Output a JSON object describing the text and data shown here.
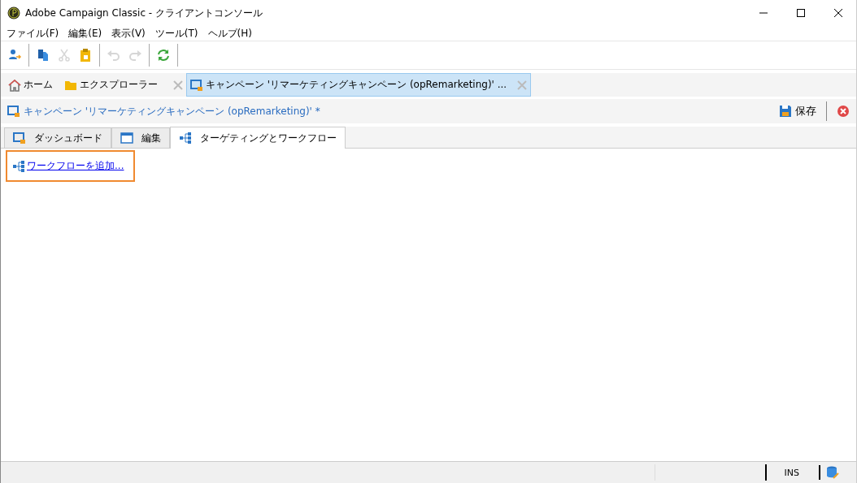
{
  "window": {
    "title": "Adobe Campaign Classic - クライアントコンソール"
  },
  "menu": [
    "ファイル(F)",
    "編集(E)",
    "表示(V)",
    "ツール(T)",
    "ヘルプ(H)"
  ],
  "toolbar": [
    {
      "kind": "person",
      "disabled": false
    },
    {
      "kind": "sep"
    },
    {
      "kind": "copy",
      "disabled": false
    },
    {
      "kind": "cut",
      "disabled": true
    },
    {
      "kind": "paste",
      "disabled": false
    },
    {
      "kind": "sep"
    },
    {
      "kind": "undo",
      "disabled": true
    },
    {
      "kind": "redo",
      "disabled": true
    },
    {
      "kind": "sep"
    },
    {
      "kind": "refresh",
      "disabled": false
    },
    {
      "kind": "sep"
    }
  ],
  "doc_tabs": [
    {
      "kind": "home",
      "label": "ホーム",
      "selected": false
    },
    {
      "kind": "folder",
      "label": "エクスプローラー",
      "selected": false
    },
    {
      "kind": "campaign",
      "label": "キャンペーン 'リマーケティングキャンペーン (opRemarketing)' ...",
      "selected": true
    }
  ],
  "header": {
    "title": "キャンペーン 'リマーケティングキャンペーン (opRemarketing)' *",
    "save": "保存"
  },
  "sub_tabs": [
    {
      "kind": "dashboard",
      "label": "ダッシュボード",
      "selected": false
    },
    {
      "kind": "edit",
      "label": "編集",
      "selected": false
    },
    {
      "kind": "workflow",
      "label": "ターゲティングとワークフロー",
      "selected": true
    }
  ],
  "add_workflow_link": "ワークフローを追加...",
  "status_bar": {
    "mode": "INS"
  }
}
